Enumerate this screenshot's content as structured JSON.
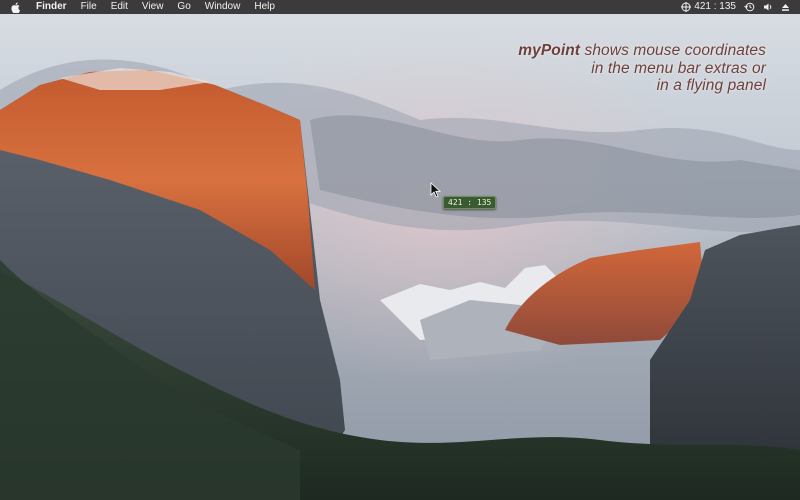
{
  "menubar": {
    "app_name": "Finder",
    "items": [
      "File",
      "Edit",
      "View",
      "Go",
      "Window",
      "Help"
    ],
    "extras": {
      "coordinates": "421 : 135"
    }
  },
  "promo": {
    "brand": "myPoint",
    "line1_rest": " shows mouse coordinates",
    "line2": "in the menu bar extras or",
    "line3": "in a flying panel"
  },
  "flying_panel": {
    "coordinates": "421 : 135"
  }
}
